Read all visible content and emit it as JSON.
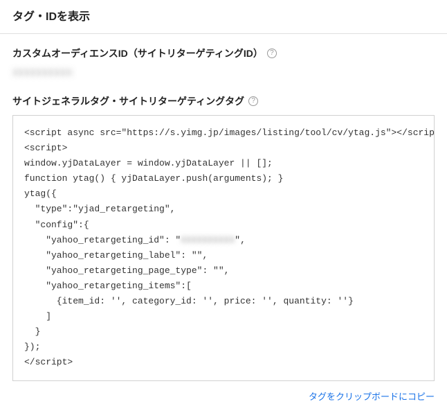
{
  "page": {
    "title": "タグ・IDを表示"
  },
  "section_audience": {
    "heading": "カスタムオーディエンスID（サイトリターゲティングID）",
    "help_tooltip": "?",
    "value_redacted": "XXXXXXXXXX"
  },
  "section_tag": {
    "heading": "サイトジェネラルタグ・サイトリターゲティングタグ",
    "help_tooltip": "?",
    "code": {
      "line1": "<script async src=\"https://s.yimg.jp/images/listing/tool/cv/ytag.js\"></script>",
      "line2": "<script>",
      "line3": "window.yjDataLayer = window.yjDataLayer || [];",
      "line4": "function ytag() { yjDataLayer.push(arguments); }",
      "line5": "ytag({",
      "line6": "  \"type\":\"yjad_retargeting\",",
      "line7": "  \"config\":{",
      "line8a": "    \"yahoo_retargeting_id\": \"",
      "line8_redacted": "XXXXXXXXXX",
      "line8b": "\",",
      "line9": "    \"yahoo_retargeting_label\": \"\",",
      "line10": "    \"yahoo_retargeting_page_type\": \"\",",
      "line11": "    \"yahoo_retargeting_items\":[",
      "line12": "      {item_id: '', category_id: '', price: '', quantity: ''}",
      "line13": "    ]",
      "line14": "  }",
      "line15": "});",
      "line16": "</script>"
    }
  },
  "copy_link": {
    "label": "タグをクリップボードにコピー"
  }
}
